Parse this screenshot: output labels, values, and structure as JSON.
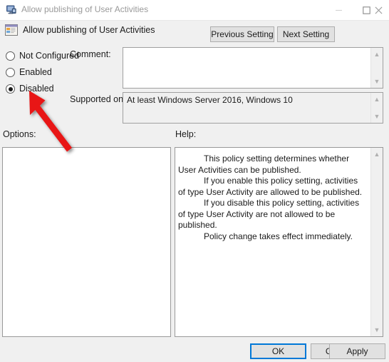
{
  "window": {
    "title": "Allow publishing of User Activities",
    "title_icon": "policy-monitor-icon",
    "controls": {
      "minimize": "minimize-icon",
      "maximize": "maximize-icon",
      "close": "close-icon"
    }
  },
  "header": {
    "icon": "group-policy-setting-icon",
    "title": "Allow publishing of User Activities",
    "previous_setting": "Previous Setting",
    "next_setting": "Next Setting"
  },
  "state_options": [
    {
      "label": "Not Configured",
      "selected": false
    },
    {
      "label": "Enabled",
      "selected": false
    },
    {
      "label": "Disabled",
      "selected": true
    }
  ],
  "fields": {
    "comment_label": "Comment:",
    "comment_value": "",
    "supported_on_label": "Supported on:",
    "supported_on_value": "At least Windows Server 2016, Windows 10"
  },
  "panels": {
    "options_label": "Options:",
    "options_content": "",
    "help_label": "Help:",
    "help_paragraphs": [
      "This policy setting determines whether User Activities can be published.",
      "If you enable this policy setting, activities of type User Activity are allowed to be published.",
      "If you disable this policy setting, activities of type User Activity are not allowed to be published.",
      "Policy change takes effect immediately."
    ]
  },
  "footer": {
    "ok": "OK",
    "cancel": "Cancel",
    "apply": "Apply"
  },
  "annotation": {
    "type": "arrow",
    "color": "#e81313",
    "points_to": "Disabled radio button"
  }
}
